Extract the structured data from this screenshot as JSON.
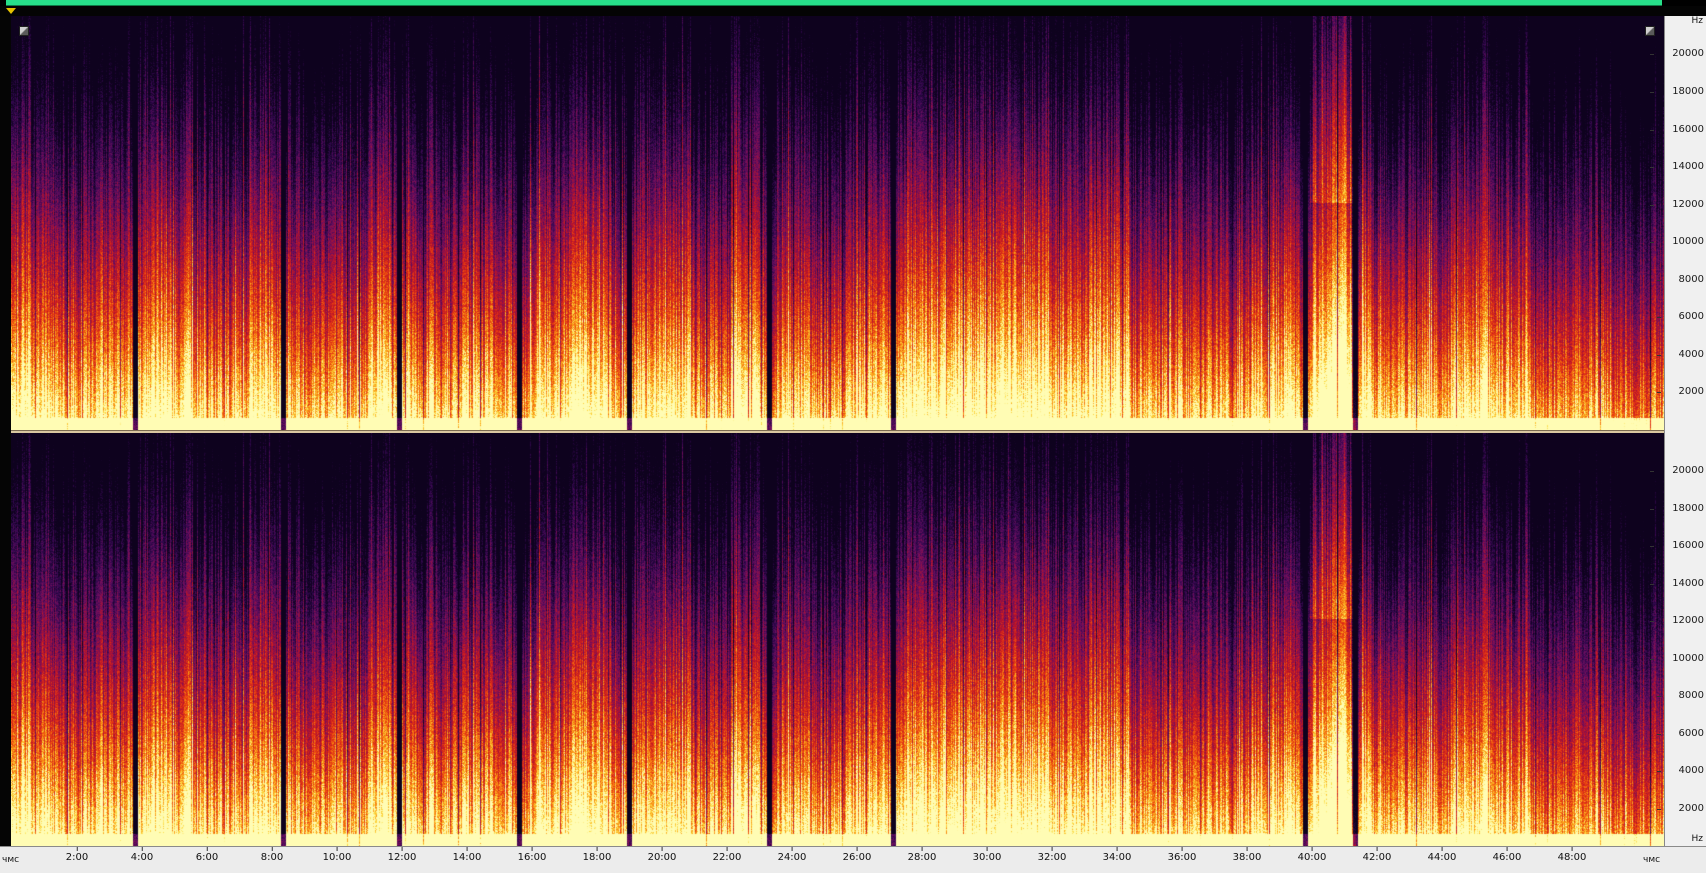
{
  "window": {
    "overview_color": "#27e08a",
    "playhead_color": "#e6c200"
  },
  "spectrogram": {
    "colormap": "inferno (black-purple-red-orange-yellow)",
    "channels": [
      {
        "name": "top"
      },
      {
        "name": "bottom"
      }
    ]
  },
  "freq_axis": {
    "unit": "Hz",
    "ticks": [
      "20000",
      "18000",
      "16000",
      "14000",
      "12000",
      "10000",
      "8000",
      "6000",
      "4000",
      "2000"
    ]
  },
  "time_axis": {
    "start_label": "чмс",
    "end_label": "чмс",
    "ticks": [
      "2:00",
      "4:00",
      "6:00",
      "8:00",
      "10:00",
      "12:00",
      "14:00",
      "16:00",
      "18:00",
      "20:00",
      "22:00",
      "24:00",
      "26:00",
      "28:00",
      "30:00",
      "32:00",
      "34:00",
      "36:00",
      "38:00",
      "40:00",
      "42:00",
      "44:00",
      "46:00",
      "48:00"
    ]
  },
  "icons": {
    "zoom_left": "zoom-corner-icon",
    "zoom_right": "zoom-corner-icon"
  }
}
